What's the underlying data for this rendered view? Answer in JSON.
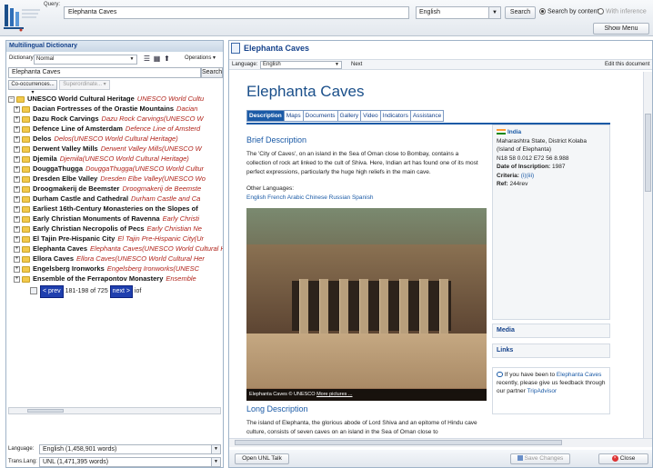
{
  "header": {
    "query_label": "Query:",
    "query_value": "Elephanta Caves",
    "language": "English",
    "search_label": "Search",
    "search_by_content": "Search by content",
    "with_inference": "With inference",
    "show_menu": "Show Menu"
  },
  "left": {
    "title": "Multilingual Dictionary",
    "dictionary_label": "Dictionary:",
    "dictionary_value": "Normal",
    "operations": "Operations",
    "search_value": "Elephanta Caves",
    "search_button": "Search",
    "cooccurrences": "Co-occurrences...",
    "superordinate": "Superordinate...",
    "tree": [
      {
        "name": "UNESCO World Cultural Heritage",
        "alt": "UNESCO World Cultu"
      },
      {
        "name": "Dacian Fortresses of the Orastie Mountains",
        "alt": "Dacian"
      },
      {
        "name": "Dazu Rock Carvings",
        "alt": "Dazu Rock Carvings(UNESCO W"
      },
      {
        "name": "Defence Line of Amsterdam",
        "alt": "Defence Line of Amsterd"
      },
      {
        "name": "Delos",
        "alt": "Delos(UNESCO World Cultural Heritage)"
      },
      {
        "name": "Derwent Valley Mills",
        "alt": "Derwent Valley Mills(UNESCO W"
      },
      {
        "name": "Djemila",
        "alt": "Djemila(UNESCO World Cultural Heritage)"
      },
      {
        "name": "DouggaThugga",
        "alt": "DouggaThugga(UNESCO World Cultur"
      },
      {
        "name": "Dresden Elbe Valley",
        "alt": "Dresden Elbe Valley(UNESCO Wo"
      },
      {
        "name": "Droogmakerij de Beemster",
        "alt": "Droogmakerij de Beemste"
      },
      {
        "name": "Durham Castle and Cathedral",
        "alt": "Durham Castle and Ca"
      },
      {
        "name": "Earliest 16th-Century Monasteries on the Slopes of",
        "alt": ""
      },
      {
        "name": "Early Christian Monuments of Ravenna",
        "alt": "Early Christi"
      },
      {
        "name": "Early Christian Necropolis of Pecs",
        "alt": "Early Christian Ne"
      },
      {
        "name": "El Tajin Pre-Hispanic City",
        "alt": "El Tajin Pre-Hispanic City(Ur"
      },
      {
        "name": "Elephanta Caves",
        "alt": "Elephanta Caves(UNESCO World Cultural He"
      },
      {
        "name": "Ellora Caves",
        "alt": "Ellora Caves(UNESCO World Cultural Her"
      },
      {
        "name": "Engelsberg Ironworks",
        "alt": "Engelsberg Ironworks(UNESC"
      },
      {
        "name": "Ensemble of the Ferrapontov Monastery",
        "alt": "Ensemble"
      }
    ],
    "pager": {
      "prev": "< prev",
      "range": "181-198 of 725",
      "next": "next >",
      "extra": "iof"
    },
    "language_label": "Language:",
    "language_value": "English (1,458,901 words)",
    "trans_label": "Trans.Lang:",
    "trans_value": "UNL (1,471,395 words)"
  },
  "right": {
    "title": "Elephanta Caves",
    "language_label": "Language:",
    "language_value": "English",
    "next": "Next",
    "edit": "Edit this document",
    "doc_title": "Elephanta Caves",
    "tabs": [
      "Description",
      "Maps",
      "Documents",
      "Gallery",
      "Video",
      "Indicators",
      "Assistance"
    ],
    "brief_heading": "Brief Description",
    "brief_text": "The 'City of Caves', on an island in the Sea of Oman close to Bombay, contains a collection of rock art linked to the cult of Shiva. Here, Indian art has found one of its most perfect expressions, particularly the huge high reliefs in the main cave.",
    "other_languages_label": "Other Languages:",
    "other_languages": "English French Arabic Chinese Russian Spanish",
    "photo_caption": "Elephanta Caves © UNESCO",
    "more_pictures": "More pictures ...",
    "long_heading": "Long Description",
    "long_text": "The island of Elephanta, the glorious abode of Lord Shiva and an epitome of Hindu cave culture, consists of seven caves on an island in the Sea of Oman close to",
    "info": {
      "country": "India",
      "state": "Maharashtra State, District Kolaba (Island of Elephanta)",
      "coords": "N18 58 0.012 E72 56 8.988",
      "inscription_label": "Date of Inscription:",
      "inscription": "1987",
      "criteria_label": "Criteria:",
      "criteria": "(i)(iii)",
      "ref_label": "Ref:",
      "ref": "244rev"
    },
    "media": "Media",
    "links": "Links",
    "trip_prefix": "If you have been to",
    "trip_link": "Elephanta Caves",
    "trip_mid": "recently, please give us feedback through our partner",
    "trip_partner": "TripAdvisor",
    "open_unl": "Open UNL Talk",
    "save_changes": "Save Changes",
    "close": "Close"
  }
}
